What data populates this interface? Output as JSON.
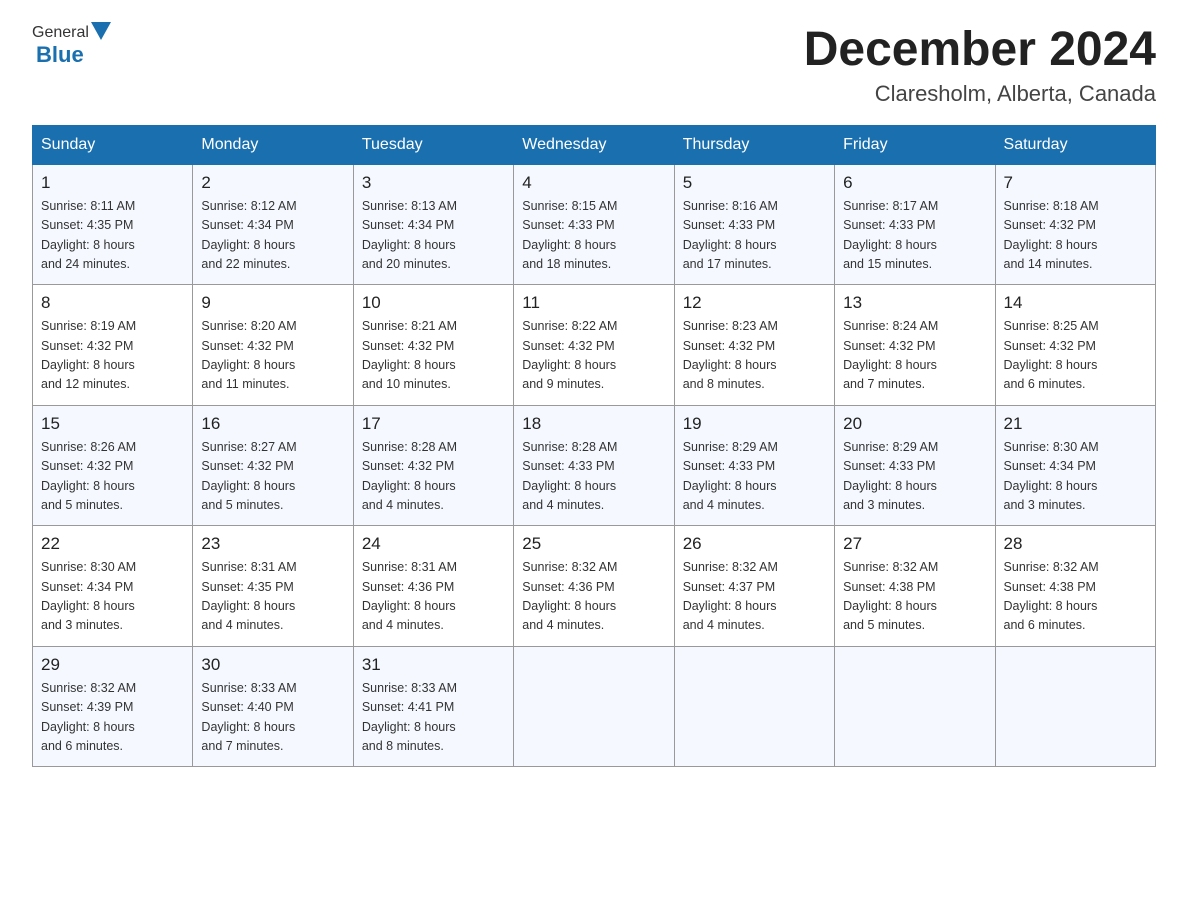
{
  "header": {
    "month_year": "December 2024",
    "location": "Claresholm, Alberta, Canada",
    "logo_general": "General",
    "logo_blue": "Blue"
  },
  "days_of_week": [
    "Sunday",
    "Monday",
    "Tuesday",
    "Wednesday",
    "Thursday",
    "Friday",
    "Saturday"
  ],
  "weeks": [
    [
      {
        "day": "1",
        "sunrise": "8:11 AM",
        "sunset": "4:35 PM",
        "daylight": "8 hours and 24 minutes."
      },
      {
        "day": "2",
        "sunrise": "8:12 AM",
        "sunset": "4:34 PM",
        "daylight": "8 hours and 22 minutes."
      },
      {
        "day": "3",
        "sunrise": "8:13 AM",
        "sunset": "4:34 PM",
        "daylight": "8 hours and 20 minutes."
      },
      {
        "day": "4",
        "sunrise": "8:15 AM",
        "sunset": "4:33 PM",
        "daylight": "8 hours and 18 minutes."
      },
      {
        "day": "5",
        "sunrise": "8:16 AM",
        "sunset": "4:33 PM",
        "daylight": "8 hours and 17 minutes."
      },
      {
        "day": "6",
        "sunrise": "8:17 AM",
        "sunset": "4:33 PM",
        "daylight": "8 hours and 15 minutes."
      },
      {
        "day": "7",
        "sunrise": "8:18 AM",
        "sunset": "4:32 PM",
        "daylight": "8 hours and 14 minutes."
      }
    ],
    [
      {
        "day": "8",
        "sunrise": "8:19 AM",
        "sunset": "4:32 PM",
        "daylight": "8 hours and 12 minutes."
      },
      {
        "day": "9",
        "sunrise": "8:20 AM",
        "sunset": "4:32 PM",
        "daylight": "8 hours and 11 minutes."
      },
      {
        "day": "10",
        "sunrise": "8:21 AM",
        "sunset": "4:32 PM",
        "daylight": "8 hours and 10 minutes."
      },
      {
        "day": "11",
        "sunrise": "8:22 AM",
        "sunset": "4:32 PM",
        "daylight": "8 hours and 9 minutes."
      },
      {
        "day": "12",
        "sunrise": "8:23 AM",
        "sunset": "4:32 PM",
        "daylight": "8 hours and 8 minutes."
      },
      {
        "day": "13",
        "sunrise": "8:24 AM",
        "sunset": "4:32 PM",
        "daylight": "8 hours and 7 minutes."
      },
      {
        "day": "14",
        "sunrise": "8:25 AM",
        "sunset": "4:32 PM",
        "daylight": "8 hours and 6 minutes."
      }
    ],
    [
      {
        "day": "15",
        "sunrise": "8:26 AM",
        "sunset": "4:32 PM",
        "daylight": "8 hours and 5 minutes."
      },
      {
        "day": "16",
        "sunrise": "8:27 AM",
        "sunset": "4:32 PM",
        "daylight": "8 hours and 5 minutes."
      },
      {
        "day": "17",
        "sunrise": "8:28 AM",
        "sunset": "4:32 PM",
        "daylight": "8 hours and 4 minutes."
      },
      {
        "day": "18",
        "sunrise": "8:28 AM",
        "sunset": "4:33 PM",
        "daylight": "8 hours and 4 minutes."
      },
      {
        "day": "19",
        "sunrise": "8:29 AM",
        "sunset": "4:33 PM",
        "daylight": "8 hours and 4 minutes."
      },
      {
        "day": "20",
        "sunrise": "8:29 AM",
        "sunset": "4:33 PM",
        "daylight": "8 hours and 3 minutes."
      },
      {
        "day": "21",
        "sunrise": "8:30 AM",
        "sunset": "4:34 PM",
        "daylight": "8 hours and 3 minutes."
      }
    ],
    [
      {
        "day": "22",
        "sunrise": "8:30 AM",
        "sunset": "4:34 PM",
        "daylight": "8 hours and 3 minutes."
      },
      {
        "day": "23",
        "sunrise": "8:31 AM",
        "sunset": "4:35 PM",
        "daylight": "8 hours and 4 minutes."
      },
      {
        "day": "24",
        "sunrise": "8:31 AM",
        "sunset": "4:36 PM",
        "daylight": "8 hours and 4 minutes."
      },
      {
        "day": "25",
        "sunrise": "8:32 AM",
        "sunset": "4:36 PM",
        "daylight": "8 hours and 4 minutes."
      },
      {
        "day": "26",
        "sunrise": "8:32 AM",
        "sunset": "4:37 PM",
        "daylight": "8 hours and 4 minutes."
      },
      {
        "day": "27",
        "sunrise": "8:32 AM",
        "sunset": "4:38 PM",
        "daylight": "8 hours and 5 minutes."
      },
      {
        "day": "28",
        "sunrise": "8:32 AM",
        "sunset": "4:38 PM",
        "daylight": "8 hours and 6 minutes."
      }
    ],
    [
      {
        "day": "29",
        "sunrise": "8:32 AM",
        "sunset": "4:39 PM",
        "daylight": "8 hours and 6 minutes."
      },
      {
        "day": "30",
        "sunrise": "8:33 AM",
        "sunset": "4:40 PM",
        "daylight": "8 hours and 7 minutes."
      },
      {
        "day": "31",
        "sunrise": "8:33 AM",
        "sunset": "4:41 PM",
        "daylight": "8 hours and 8 minutes."
      },
      null,
      null,
      null,
      null
    ]
  ],
  "labels": {
    "sunrise_prefix": "Sunrise: ",
    "sunset_prefix": "Sunset: ",
    "daylight_prefix": "Daylight: "
  }
}
